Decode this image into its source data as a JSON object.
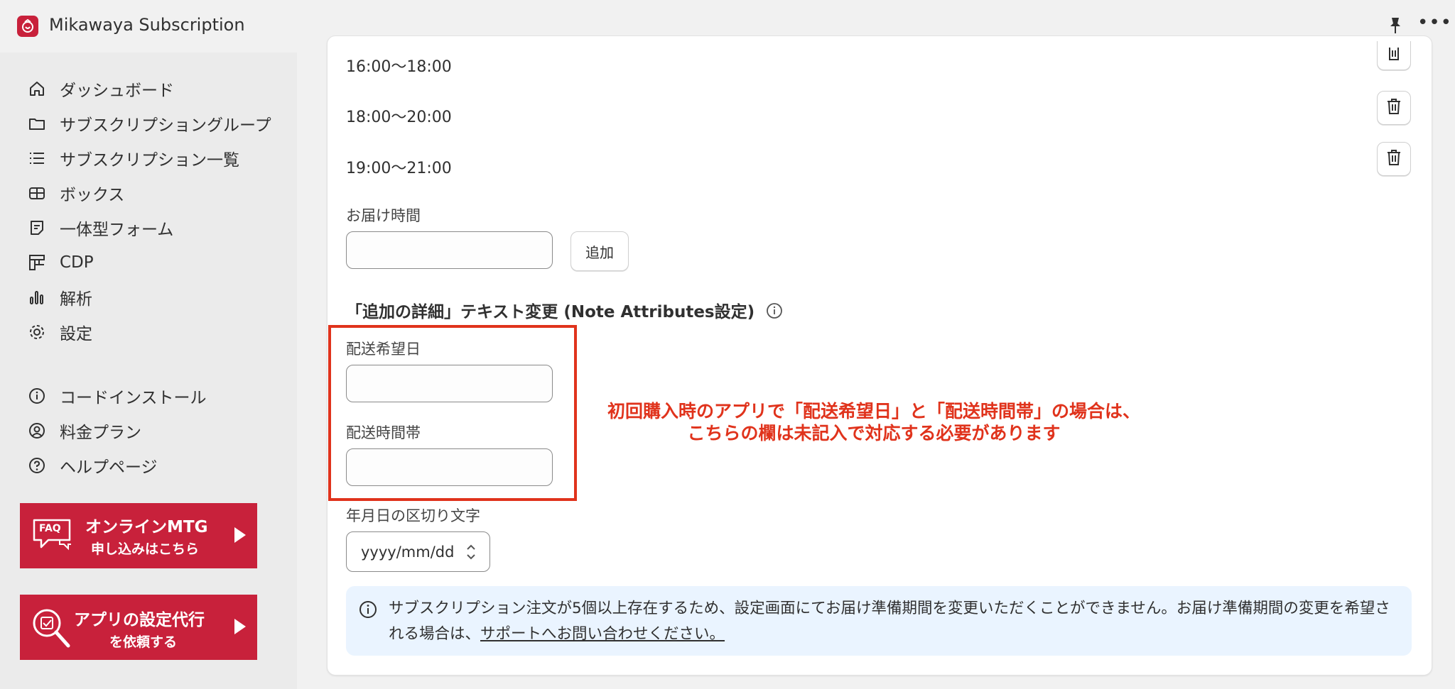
{
  "app": {
    "title": "Mikawaya Subscription"
  },
  "sidebar": {
    "items": [
      {
        "label": "ダッシュボード",
        "icon": "home-icon"
      },
      {
        "label": "サブスクリプショングループ",
        "icon": "folder-icon"
      },
      {
        "label": "サブスクリプション一覧",
        "icon": "list-icon"
      },
      {
        "label": "ボックス",
        "icon": "gift-icon"
      },
      {
        "label": "一体型フォーム",
        "icon": "form-icon"
      },
      {
        "label": "CDP",
        "icon": "grid-icon"
      },
      {
        "label": "解析",
        "icon": "chart-icon"
      },
      {
        "label": "設定",
        "icon": "gear-icon"
      }
    ],
    "secondary": [
      {
        "label": "コードインストール",
        "icon": "info-icon"
      },
      {
        "label": "料金プラン",
        "icon": "user-circle-icon"
      },
      {
        "label": "ヘルプページ",
        "icon": "help-icon"
      }
    ],
    "promo_meeting": {
      "badge": "FAQ",
      "line1": "オンラインMTG",
      "line2": "申し込みはこちら"
    },
    "promo_setup": {
      "line1": "アプリの設定代行",
      "line2": "を依頼する"
    }
  },
  "main": {
    "time_slots": [
      "16:00〜18:00",
      "18:00〜20:00",
      "19:00〜21:00"
    ],
    "delivery_time_label": "お届け時間",
    "delivery_time_value": "",
    "add_button": "追加",
    "note_section_title": "「追加の詳細」テキスト変更 (Note Attributes設定)",
    "desired_date_label": "配送希望日",
    "desired_date_value": "",
    "time_slot_label": "配送時間帯",
    "time_slot_value": "",
    "annotation_line1": "初回購入時のアプリで「配送希望日」と「配送時間帯」の場合は、",
    "annotation_line2": "こちらの欄は未記入で対応する必要があります",
    "separator_label": "年月日の区切り文字",
    "separator_value": "yyyy/mm/dd",
    "banner_text": "サブスクリプション注文が5個以上存在するため、設定画面にてお届け準備期間を変更いただくことができません。お届け準備期間の変更を希望される場合は、",
    "banner_link": "サポートへお問い合わせください。"
  },
  "colors": {
    "brand": "#c8213b",
    "annotation": "#e0331c",
    "banner_bg": "#eaf4ff"
  }
}
